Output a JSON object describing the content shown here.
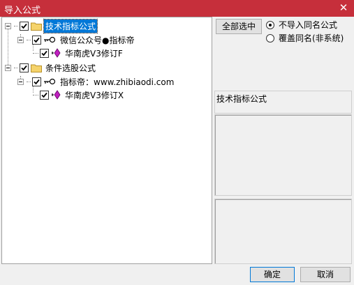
{
  "window": {
    "title": "导入公式",
    "close_glyph": "✕"
  },
  "tree": {
    "nodes": [
      {
        "label": "技术指标公式",
        "checked": true,
        "selected": true
      },
      {
        "label": "微信公众号●指标帝",
        "checked": true
      },
      {
        "label": "华南虎V3修订F",
        "checked": true
      },
      {
        "label": "条件选股公式",
        "checked": true
      },
      {
        "label": "指标帝：www.zhibiaodi.com",
        "checked": true
      },
      {
        "label": "华南虎V3修订X",
        "checked": true
      }
    ]
  },
  "options": {
    "select_all_label": "全部选中",
    "radio_skip_label": "不导入同名公式",
    "radio_overwrite_label": "覆盖同名(非系统)",
    "selected_radio": "skip"
  },
  "info": {
    "category_label": "技术指标公式"
  },
  "footer": {
    "ok_label": "确定",
    "cancel_label": "取消"
  },
  "colors": {
    "titlebar": "#c62f3b",
    "selection": "#0078d7",
    "folder": "#f5d36b",
    "gem": "#c020c0"
  }
}
